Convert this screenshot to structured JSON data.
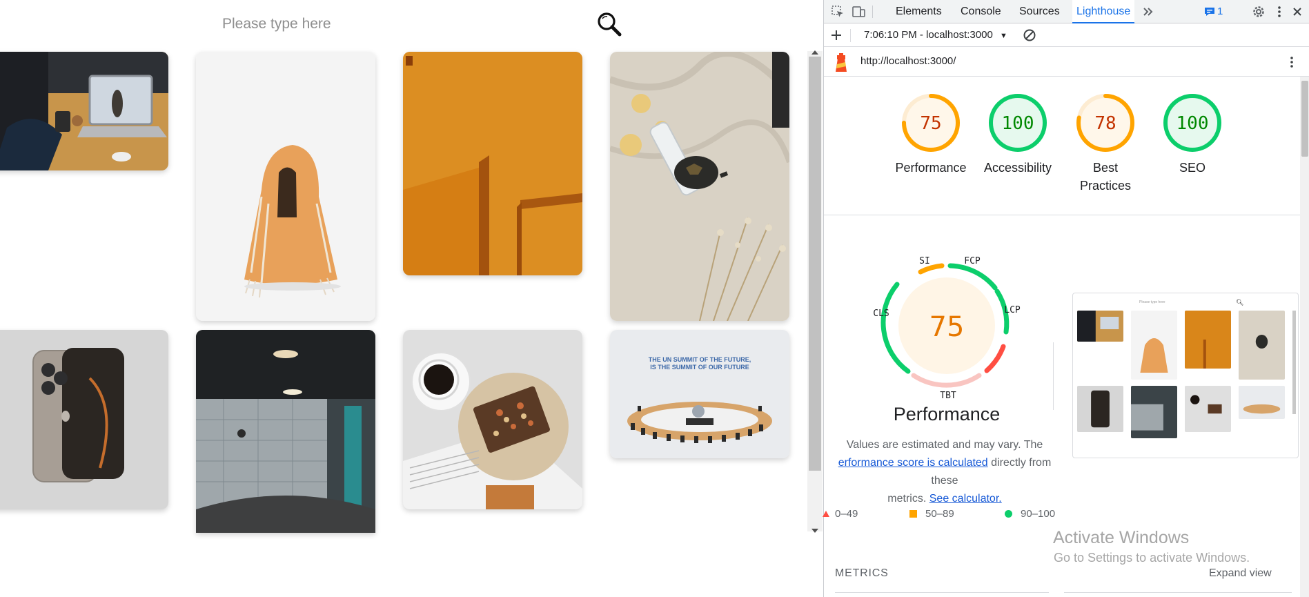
{
  "search": {
    "placeholder": "Please type here",
    "icon": "magnifier-icon"
  },
  "gallery": {
    "images": [
      {
        "name": "laptop-desk-photo",
        "desc_color": "#c8954b"
      },
      {
        "name": "blanket-dog-photo",
        "desc_color": "#e8a15a"
      },
      {
        "name": "orange-wall-photo",
        "desc_color": "#d9861a"
      },
      {
        "name": "tortoise-linen-photo",
        "desc_color": "#d9d2c5"
      },
      {
        "name": "iphone-photo",
        "desc_color": "#d6d6d6"
      },
      {
        "name": "tunnel-corridor-photo",
        "desc_color": "#5d6a70"
      },
      {
        "name": "coffee-chocolate-photo",
        "desc_color": "#cfcfcf"
      },
      {
        "name": "un-summit-photo",
        "desc_color": "#e9ebee",
        "caption": "THE UN SUMMIT OF THE FUTURE, IS THE SUMMIT OF OUR FUTURE"
      }
    ]
  },
  "devtools": {
    "tabs": [
      "Elements",
      "Console",
      "Sources",
      "Lighthouse"
    ],
    "active_tab": "Lighthouse",
    "issues_count": "1",
    "report_select": "7:06:10 PM - localhost:3000",
    "url": "http://localhost:3000/",
    "scores": [
      {
        "value": "75",
        "label": "Performance",
        "level": "average"
      },
      {
        "value": "100",
        "label": "Accessibility",
        "level": "pass"
      },
      {
        "value": "78",
        "label": "Best Practices",
        "level": "average"
      },
      {
        "value": "100",
        "label": "SEO",
        "level": "pass"
      }
    ],
    "perf_gauge": {
      "score": "75",
      "title": "Performance",
      "metric_labels": {
        "si": "SI",
        "fcp": "FCP",
        "lcp": "LCP",
        "tbt": "TBT",
        "cls": "CLS"
      }
    },
    "perf_desc": {
      "line1": "Values are estimated and may vary. The",
      "link1": "erformance score is calculated",
      "mid": " directly from these",
      "line3": "metrics. ",
      "link2": "See calculator."
    },
    "legend": [
      {
        "range": "0–49",
        "color": "#ff4e42"
      },
      {
        "range": "50–89",
        "color": "#ffa400"
      },
      {
        "range": "90–100",
        "color": "#0cce6b"
      }
    ],
    "thumb_placeholder": "Please type here",
    "watermark": {
      "line1": "Activate Windows",
      "line2": "Go to Settings to activate Windows."
    },
    "metrics_title": "METRICS",
    "expand_view": "Expand view",
    "colors": {
      "pass": "#0cce6b",
      "average": "#ffa400",
      "fail": "#ff4e42",
      "accent": "#1a73e8"
    }
  }
}
